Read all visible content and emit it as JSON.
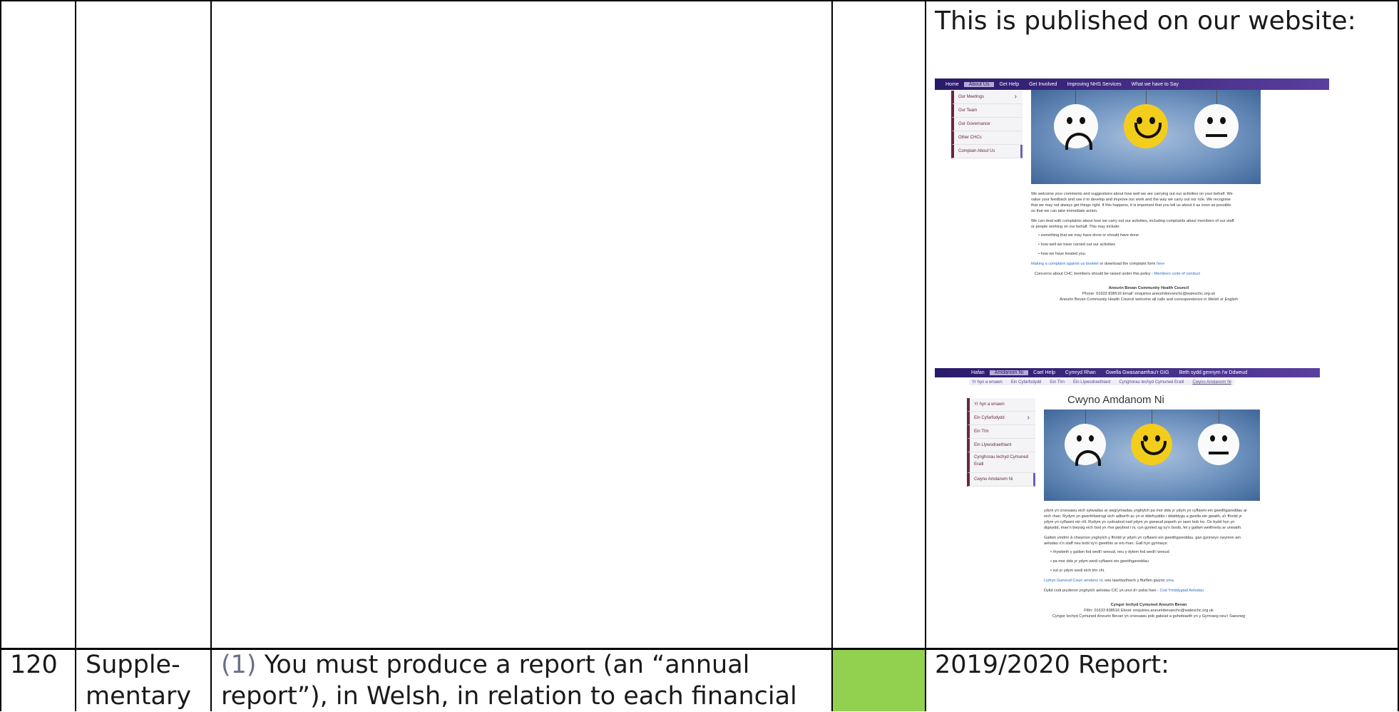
{
  "row_top": {
    "col5_heading": "This is published on our website:"
  },
  "row_bottom": {
    "number": "120",
    "type_line1": "Supple-",
    "type_line2": "mentary",
    "requirement_ref": "(1)",
    "requirement_line1": " You must produce a report (an “annual",
    "requirement_line2": "report”), in Welsh, in relation to each financial",
    "col5_text": "2019/2020 Report:"
  },
  "colors": {
    "status_green": "#92d050",
    "nav_purple": "#3b2a7a",
    "sidebar_border": "#6b2440"
  },
  "screenshot_english": {
    "nav": [
      "Home",
      "About Us",
      "Get Help",
      "Get Involved",
      "Improving NHS Services",
      "What we have to Say"
    ],
    "nav_active_index": 1,
    "side_menu": [
      "Our Meetings",
      "Our Team",
      "Our Governance",
      "Other CHCs",
      "Complain About Us"
    ],
    "paragraphs": [
      "We welcome your comments and suggestions about how well we are carrying out our activities on your behalf. We",
      "value your feedback and use it to develop and improve our work and the way we carry out our role. We recognise",
      "that we may not always get things right. If this happens, it is important that you tell us about it as soon as possible",
      "so that we can take immediate action."
    ],
    "paragraph2": [
      "We can deal with complaints about how we carry out our activities, including complaints about members of our staff",
      "or people working on our behalf. This may include:"
    ],
    "bullets": [
      "something that we may have done or should have done",
      "how well we have carried out our activities",
      "how we have treated you."
    ],
    "link_line_a": "Making a complaint against us booklet",
    "link_line_b": " or download the complaint form ",
    "link_line_c": "here",
    "concerns_a": "Concerns about CHC members should be raised under this policy - ",
    "concerns_b": "Members code of conduct",
    "footer_org": "Aneurin Bevan Community Health Council",
    "footer_phone": "Phone: 01633 838516  Email: enquiries.aneurinbevanchc@waleschc.org.uk",
    "footer_welsh": "Aneurin Bevan Community Health Council welcome all calls and correspondence in Welsh or English"
  },
  "screenshot_welsh": {
    "nav": [
      "Hafan",
      "Amdanom Ni",
      "Cael Help",
      "Cymryd Rhan",
      "Gwella Gwasanaethau'r GIG",
      "Beth sydd gennym i'w Ddweud"
    ],
    "nav_active_index": 1,
    "subnav": [
      "Yr hyn a wnawn",
      "Ein Cyfarfodydd",
      "Ein Tîm",
      "Ein Llywodraethiant",
      "Cynghorau Iechyd Cymuned Eraill",
      "Cwyno Amdanom Ni"
    ],
    "side_menu": [
      "Yr hyn a wnawn",
      "Ein Cyfarfodydd",
      "Ein Tîm",
      "Ein Llywodraethiant",
      "Cynghorau Iechyd Cymuned Eraill",
      "Cwyno Amdanom Ni"
    ],
    "page_heading": "Cwyno Amdanom Ni",
    "paragraphs": [
      "ydym yn croesawu eich sylwadau ar awgrymiadau ynghylch pa mor dda yr ydym yn cyflawni ein gweithgareddau ar",
      "eich rhan. Rydym yn gwerthfawrogi eich adborth ac yn ei ddefnyddio i ddatblygu a gwella ein gwaith, a'r ffordd yr",
      "ydym yn cyflawni ein rôl. Rydym yn cydnabod nad ydym yn gwneud popeth yn iawn bob tro. Os bydd hyn yn",
      "digwydd, mae'n bwysig eich bod yn rhoi gwybod i ni, cyn gynted ag sy'n bosib, fel y gallwn weithredu ar unwaith."
    ],
    "paragraph2": [
      "Gallwn ymdrin â chwynion ynghylch y ffordd yr ydym yn cyflawni ein gweithgareddau, gan gynnwys cwynion am",
      "aelodau o'n staff neu bobl sy'n gweithio ar ein rhan. Gall hyn gynnwys:"
    ],
    "bullets": [
      "rhywbeth y gallwn fod wedi'i wneud, neu y dylem fod wedi'i wneud",
      "pa mor dda yr ydym wedi cyflawni ein gweithgareddau",
      "sut yr ydym wedi eich trin chi."
    ],
    "link_line_a": "Llyfryn Gwneud Cwyn amdano ni",
    "link_line_b": ", neu lawrlwythwch y ffurflen gwyno ",
    "link_line_c": "yma.",
    "concerns_a": "Dylid codi pryderon ynghylch aelodau CIC yn unol â'r polisi hwn - ",
    "concerns_b": "Cod Ymddygiad Aelodau",
    "footer_org": "Cyngor Iechyd Cymuned Aneurin Bevan",
    "footer_phone": "Ffôn: 01633 838516  Ebost: enquiries.aneurinbevanchc@waleschc.org.uk",
    "footer_welsh": "Cyngor Iechyd Cymuned Aneurin Bevan yn croesawu pob galwad a gohebiaeth yn y Gymraeg neu'r Saesneg"
  }
}
